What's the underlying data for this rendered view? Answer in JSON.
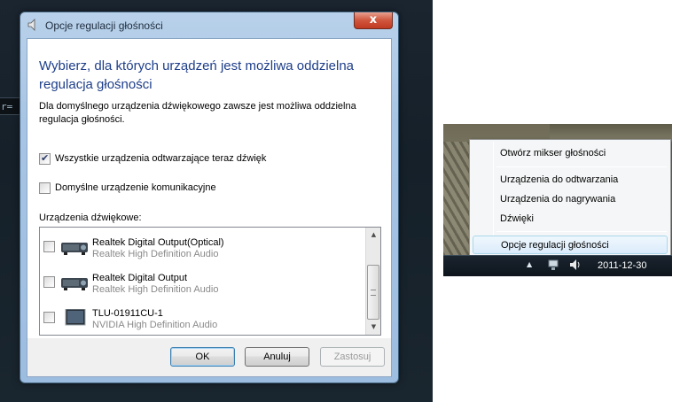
{
  "desktop": {
    "edge_text": "r="
  },
  "dialog": {
    "title": "Opcje regulacji głośności",
    "close_glyph": "x",
    "heading": "Wybierz, dla których urządzeń jest możliwa oddzielna regulacja głośności",
    "description": "Dla domyślnego urządzenia dźwiękowego zawsze jest możliwa oddzielna regulacja głośności.",
    "checkbox_all_playback": {
      "label": "Wszystkie urządzenia odtwarzające teraz dźwięk",
      "checked": true
    },
    "checkbox_default_comm": {
      "label": "Domyślne urządzenie komunikacyjne",
      "checked": false
    },
    "devices_label": "Urządzenia dźwiękowe:",
    "devices": [
      {
        "name": "Realtek Digital Output(Optical)",
        "driver": "Realtek High Definition Audio",
        "checked": false,
        "icon": "speaker-device-icon"
      },
      {
        "name": "Realtek Digital Output",
        "driver": "Realtek High Definition Audio",
        "checked": false,
        "icon": "speaker-device-icon"
      },
      {
        "name": "TLU-01911CU-1",
        "driver": "NVIDIA High Definition Audio",
        "checked": false,
        "icon": "monitor-device-icon"
      }
    ],
    "buttons": {
      "ok": "OK",
      "cancel": "Anuluj",
      "apply": "Zastosuj"
    }
  },
  "tray": {
    "menu_items": [
      {
        "label": "Otwórz mikser głośności",
        "highlighted": false
      },
      {
        "label": "Urządzenia do odtwarzania",
        "highlighted": false
      },
      {
        "label": "Urządzenia do nagrywania",
        "highlighted": false
      },
      {
        "label": "Dźwięki",
        "highlighted": false
      },
      {
        "label": "Opcje regulacji głośności",
        "highlighted": true
      }
    ],
    "date": "2011-12-30",
    "icons": [
      "show-hidden-icons-arrow",
      "network-icon",
      "volume-icon"
    ]
  },
  "colors": {
    "heading": "#1e3e8a",
    "window_frame": "#a7c4e4",
    "close_button": "#c03a21",
    "menu_highlight": "#dcecfc"
  }
}
